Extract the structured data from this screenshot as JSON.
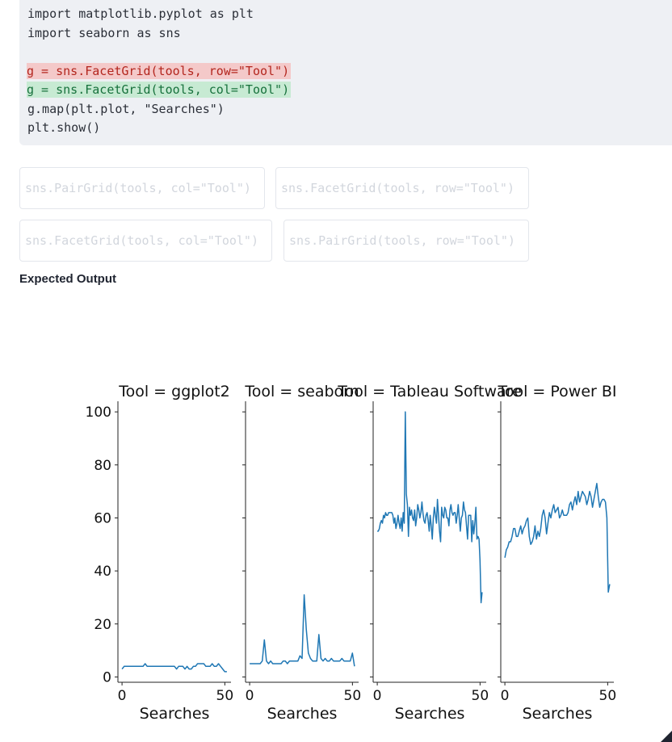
{
  "code": {
    "lines": [
      {
        "text": "import matplotlib.pyplot as plt",
        "kind": "normal"
      },
      {
        "text": "import seaborn as sns",
        "kind": "normal"
      },
      {
        "text": "",
        "kind": "normal"
      },
      {
        "text": "g = sns.FacetGrid(tools, row=\"Tool\")",
        "kind": "removed"
      },
      {
        "text": "g = sns.FacetGrid(tools, col=\"Tool\")",
        "kind": "added"
      },
      {
        "text": "g.map(plt.plot, \"Searches\")",
        "kind": "normal"
      },
      {
        "text": "plt.show()",
        "kind": "normal"
      }
    ],
    "removed_color": "#b3261e",
    "added_color": "#17713c"
  },
  "options": [
    "sns.PairGrid(tools, col=\"Tool\")",
    "sns.FacetGrid(tools, row=\"Tool\")",
    "sns.FacetGrid(tools, col=\"Tool\")",
    "sns.PairGrid(tools, row=\"Tool\")"
  ],
  "expected_output_label": "Expected Output",
  "chart_data": {
    "type": "line",
    "xlabel": "Searches",
    "ylabel": "",
    "xlim": [
      -2,
      53
    ],
    "ylim": [
      -2,
      104
    ],
    "xticks": [
      0,
      50
    ],
    "yticks": [
      0,
      20,
      40,
      60,
      80,
      100
    ],
    "line_color": "#1f77b4",
    "facets": [
      {
        "title": "Tool = ggplot2",
        "values": [
          3,
          4,
          4,
          4,
          4,
          4,
          4,
          4,
          4,
          4,
          4,
          5,
          4,
          4,
          4,
          4,
          4,
          4,
          4,
          4,
          4,
          4,
          4,
          4,
          4,
          4,
          3,
          4,
          4,
          4,
          3,
          4,
          3,
          3,
          4,
          4,
          5,
          5,
          5,
          5,
          4,
          4,
          4,
          5,
          4,
          4,
          5,
          4,
          3,
          2,
          2
        ]
      },
      {
        "title": "Tool = seaborn",
        "values": [
          5,
          5,
          5,
          5,
          5,
          5,
          6,
          14,
          6,
          5,
          6,
          5,
          5,
          5,
          5,
          5,
          6,
          6,
          5,
          6,
          6,
          6,
          6,
          6,
          8,
          7,
          31,
          18,
          9,
          7,
          6,
          6,
          6,
          16,
          7,
          6,
          7,
          6,
          6,
          7,
          6,
          6,
          6,
          6,
          7,
          6,
          6,
          6,
          6,
          9,
          4
        ]
      },
      {
        "title": "Tool = Tableau Software",
        "values": [
          55,
          55,
          56,
          58,
          59,
          58,
          61,
          60,
          62,
          61,
          61,
          62,
          62,
          62,
          62,
          61,
          58,
          60,
          56,
          58,
          61,
          58,
          56,
          60,
          55,
          62,
          58,
          100,
          69,
          65,
          53,
          64,
          61,
          63,
          60,
          59,
          63,
          57,
          60,
          65,
          63,
          60,
          62,
          66,
          62,
          59,
          58,
          61,
          62,
          59,
          55,
          61,
          57,
          52,
          60,
          64,
          61,
          58,
          67,
          61,
          55,
          51,
          64,
          61,
          60,
          64,
          63,
          60,
          60,
          57,
          63,
          65,
          62,
          61,
          62,
          62,
          58,
          61,
          65,
          60,
          55,
          60,
          61,
          66,
          63,
          62,
          57,
          52,
          61,
          61,
          61,
          51,
          59,
          54,
          58,
          64,
          52,
          53,
          52,
          44,
          28,
          32
        ]
      },
      {
        "title": "Tool = Power BI",
        "values": [
          45,
          48,
          49,
          51,
          51,
          53,
          56,
          56,
          53,
          53,
          55,
          57,
          54,
          56,
          57,
          59,
          60,
          53,
          50,
          51,
          53,
          57,
          52,
          55,
          53,
          56,
          61,
          63,
          60,
          54,
          58,
          62,
          60,
          63,
          65,
          62,
          63,
          64,
          60,
          61,
          63,
          61,
          61,
          61,
          62,
          65,
          66,
          63,
          66,
          68,
          65,
          70,
          66,
          68,
          70,
          69,
          68,
          65,
          67,
          70,
          68,
          64,
          67,
          70,
          73,
          68,
          64,
          66,
          67,
          67,
          66,
          60,
          32,
          35
        ]
      }
    ]
  }
}
